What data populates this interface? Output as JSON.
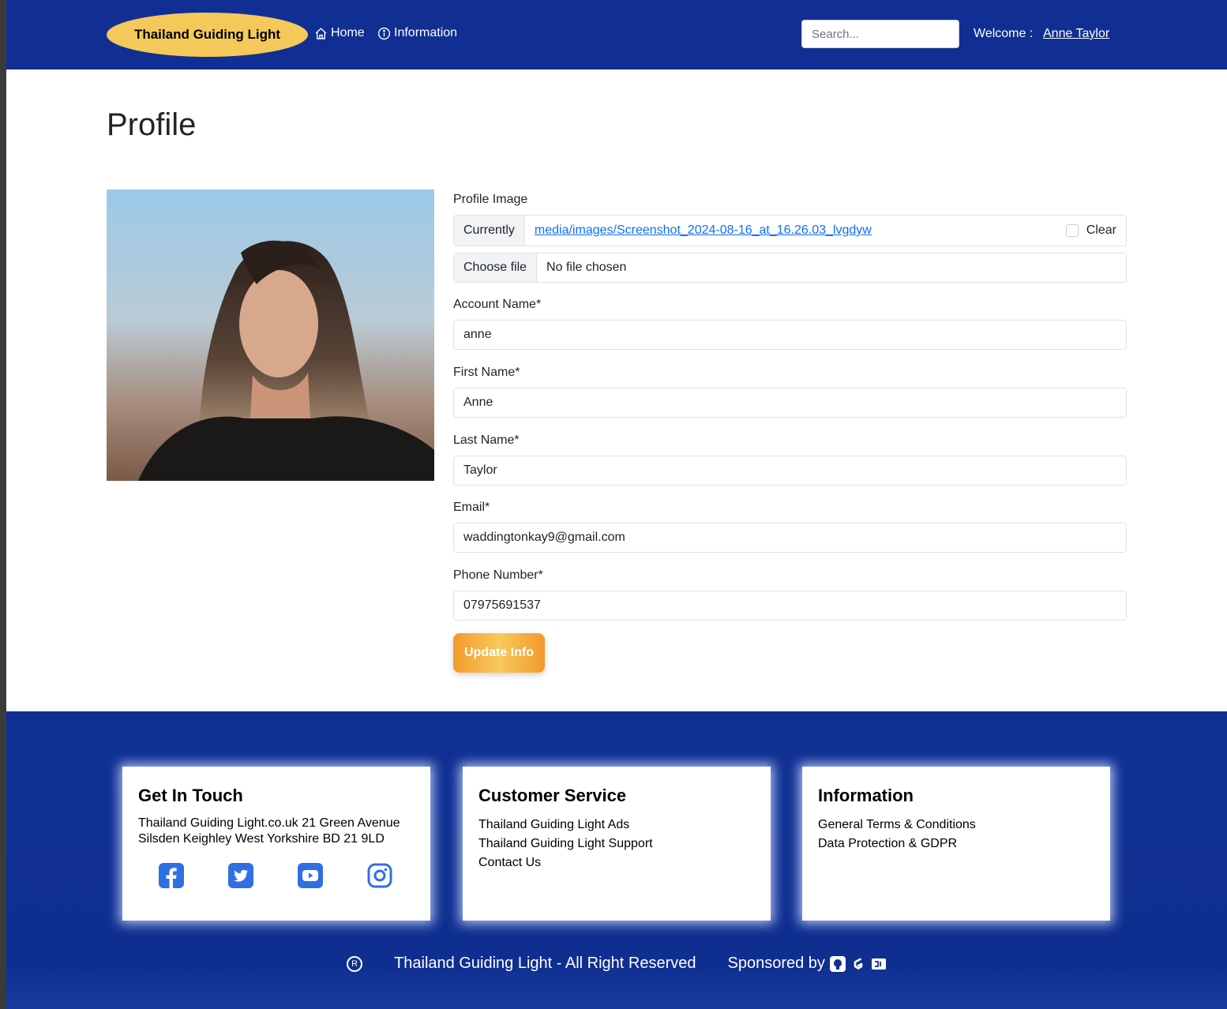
{
  "header": {
    "brand": "Thailand Guiding Light",
    "nav": {
      "home": "Home",
      "information": "Information"
    },
    "search_placeholder": "Search...",
    "welcome_label": "Welcome :",
    "user_name": "Anne Taylor"
  },
  "main": {
    "title": "Profile",
    "profile_image": {
      "label": "Profile Image",
      "currently_label": "Currently",
      "current_file": "media/images/Screenshot_2024-08-16_at_16.26.03_lvgdyw",
      "clear_label": "Clear",
      "choose_file_label": "Choose file",
      "no_file_label": "No file chosen"
    },
    "fields": {
      "account_name": {
        "label": "Account Name*",
        "value": "anne"
      },
      "first_name": {
        "label": "First Name*",
        "value": "Anne"
      },
      "last_name": {
        "label": "Last Name*",
        "value": "Taylor"
      },
      "email": {
        "label": "Email*",
        "value": "waddingtonkay9@gmail.com"
      },
      "phone": {
        "label": "Phone Number*",
        "value": "07975691537"
      }
    },
    "update_button": "Update Info"
  },
  "footer": {
    "contact": {
      "title": "Get In Touch",
      "line1": "Thailand Guiding Light.co.uk 21 Green Avenue",
      "line2": "Silsden Keighley West Yorkshire BD 21 9LD",
      "socials": [
        "facebook-icon",
        "twitter-icon",
        "youtube-icon",
        "instagram-icon"
      ]
    },
    "customer_service": {
      "title": "Customer Service",
      "links": [
        "Thailand Guiding Light Ads",
        "Thailand Guiding Light Support",
        "Contact Us"
      ]
    },
    "information": {
      "title": "Information",
      "links": [
        "General Terms & Conditions",
        "Data Protection & GDPR"
      ]
    },
    "copyright": "Thailand Guiding Light - All Right Reserved",
    "sponsored_by": "Sponsored by"
  },
  "colors": {
    "navy": "#112f93",
    "brand_pill": "#f4c95a",
    "social_blue": "#2f6fe4",
    "update_orange": "#f39a2e",
    "link_blue": "#0d6efd"
  }
}
